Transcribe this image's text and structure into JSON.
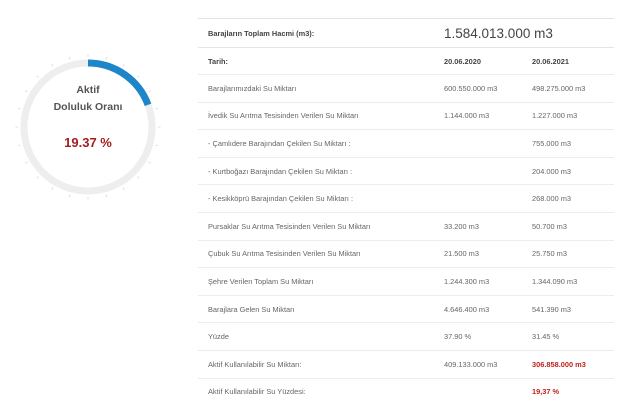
{
  "gauge": {
    "label_line1": "Aktif",
    "label_line2": "Doluluk Oranı",
    "value_text": "19.37 %",
    "fill_fraction": 0.1937,
    "fill_color": "#1d86c8",
    "track_color": "#eeeeee"
  },
  "table": {
    "total_label": "Barajların Toplam Hacmi (m3):",
    "total_value": "1.584.013.000 m3",
    "date_label": "Tarih:",
    "date_2020": "20.06.2020",
    "date_2021": "20.06.2021",
    "rows": [
      {
        "label": "Barajlarımızdaki Su Miktarı",
        "v2020": "600.550.000 m3",
        "v2021": "498.275.000 m3"
      },
      {
        "label": "İvedik Su Arıtma Tesisinden Verilen Su Miktarı",
        "v2020": "1.144.000 m3",
        "v2021": "1.227.000 m3"
      },
      {
        "label": "- Çamlıdere Barajından Çekilen Su Miktarı :",
        "v2020": "",
        "v2021": "755.000 m3"
      },
      {
        "label": "- Kurtboğazı Barajından Çekilen Su Miktarı :",
        "v2020": "",
        "v2021": "204.000 m3"
      },
      {
        "label": "- Kesikköprü Barajından Çekilen Su Miktarı :",
        "v2020": "",
        "v2021": "268.000 m3"
      },
      {
        "label": "Pursaklar Su Arıtma Tesisinden Verilen Su Miktarı",
        "v2020": "33.200 m3",
        "v2021": "50.700 m3"
      },
      {
        "label": "Çubuk Su Arıtma Tesisinden Verilen Su Miktarı",
        "v2020": "21.500 m3",
        "v2021": "25.750 m3"
      },
      {
        "label": "Şehre Verilen Toplam Su Miktarı",
        "v2020": "1.244.300 m3",
        "v2021": "1.344.090 m3"
      },
      {
        "label": "Barajlara Gelen Su Miktarı",
        "v2020": "4.646.400 m3",
        "v2021": "541.390 m3"
      },
      {
        "label": "Yüzde",
        "v2020": "37.90 %",
        "v2021": "31.45 %"
      },
      {
        "label": "Aktif Kullanılabilir Su Miktarı:",
        "v2020": "409.133.000 m3",
        "v2021": "306.858.000 m3"
      },
      {
        "label": "Aktif Kullanılabilir Su Yüzdesi:",
        "v2020": "",
        "v2021": "19,37 %"
      }
    ]
  }
}
